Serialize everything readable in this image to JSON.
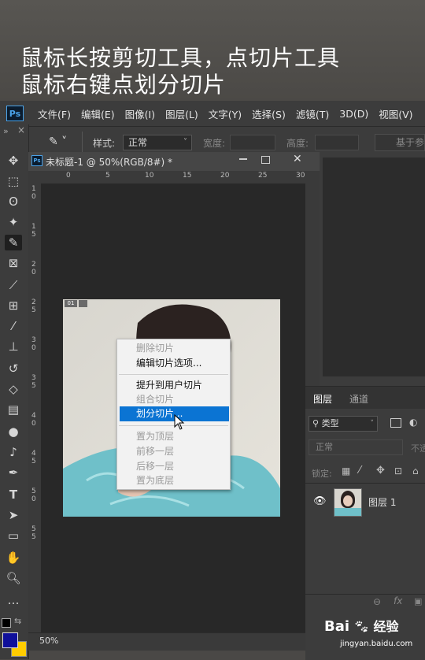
{
  "caption": {
    "line1": "鼠标长按剪切工具，点切片工具",
    "line2": "鼠标右键点划分切片"
  },
  "app": {
    "logo": "Ps"
  },
  "menubar": {
    "items": [
      "文件(F)",
      "编辑(E)",
      "图像(I)",
      "图层(L)",
      "文字(Y)",
      "选择(S)",
      "滤镜(T)",
      "3D(D)",
      "视图(V)"
    ]
  },
  "options": {
    "style_label": "样式:",
    "style_value": "正常",
    "width_label": "宽度:",
    "height_label": "高度:",
    "guides_button": "基于参"
  },
  "toolbar": {
    "collapse": "»",
    "close": "×",
    "icons": [
      "move-icon",
      "marquee-icon",
      "lasso-icon",
      "magic-wand-icon",
      "slice-icon",
      "frame-icon",
      "eyedropper-icon",
      "healing-icon",
      "brush-icon",
      "stamp-icon",
      "history-brush-icon",
      "eraser-icon",
      "gradient-icon",
      "blur-icon",
      "dodge-icon",
      "pen-icon",
      "type-icon",
      "path-select-icon",
      "rectangle-icon",
      "hand-icon",
      "zoom-icon",
      "more-icon"
    ],
    "foreground_color": "#10109a",
    "background_color": "#ffcc00"
  },
  "document": {
    "title": "未标题-1 @ 50%(RGB/8#) *",
    "zoom": "50%",
    "ruler_top": [
      "0",
      "5",
      "10",
      "15",
      "20",
      "25",
      "30"
    ],
    "ruler_left": [
      "1",
      "0",
      "1",
      "5",
      "2",
      "0",
      "2",
      "5",
      "3",
      "0",
      "3",
      "5",
      "4",
      "0",
      "4",
      "5",
      "5",
      "0",
      "5",
      "5"
    ],
    "slice_badge": "01"
  },
  "context_menu": {
    "items": [
      {
        "label": "删除切片",
        "enabled": false
      },
      {
        "label": "编辑切片选项...",
        "enabled": true
      },
      {
        "label": "提升到用户切片",
        "enabled": true
      },
      {
        "label": "组合切片",
        "enabled": false
      },
      {
        "label": "划分切片...",
        "enabled": true,
        "highlighted": true
      },
      {
        "label": "置为顶层",
        "enabled": false
      },
      {
        "label": "前移一层",
        "enabled": false
      },
      {
        "label": "后移一层",
        "enabled": false
      },
      {
        "label": "置为底层",
        "enabled": false
      }
    ]
  },
  "layers_panel": {
    "tabs": [
      "图层",
      "通道"
    ],
    "filter_label": "类型",
    "blend_mode": "正常",
    "opacity_label": "不透",
    "lock_label": "锁定:",
    "layer_name": "图层 1"
  },
  "watermark": {
    "brand": "Bai",
    "brand_suffix": "经验",
    "url": "jingyan.baidu.com"
  },
  "colors": {
    "highlight": "#0b74d3",
    "ps_blue": "#4aa2e8"
  }
}
